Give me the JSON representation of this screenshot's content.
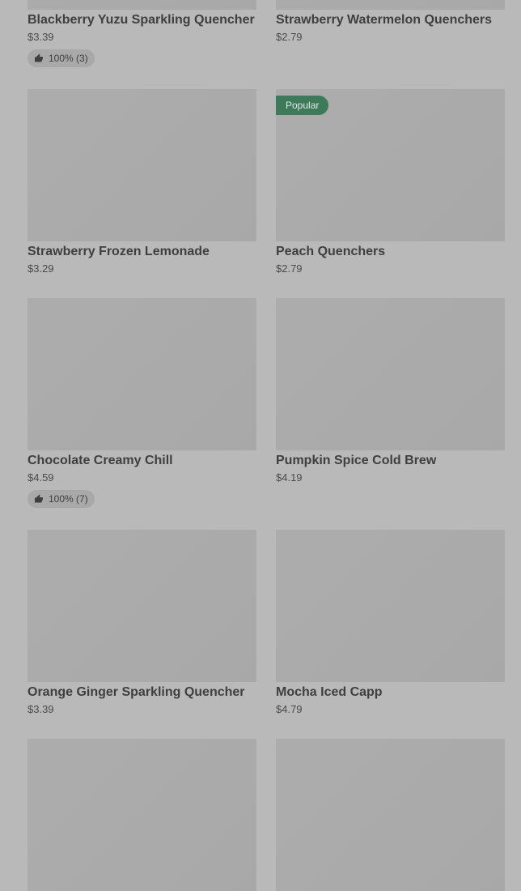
{
  "products": {
    "items": [
      {
        "name": "Blackberry Yuzu Sparkling Quencher",
        "price": "$3.39",
        "rating": "100% (3)"
      },
      {
        "name": "Strawberry Watermelon Quenchers",
        "price": "$2.79"
      },
      {
        "name": "Strawberry Frozen Lemonade",
        "price": "$3.29"
      },
      {
        "name": "Peach Quenchers",
        "price": "$2.79",
        "badge": "Popular"
      },
      {
        "name": "Chocolate Creamy Chill",
        "price": "$4.59",
        "rating": "100% (7)"
      },
      {
        "name": "Pumpkin Spice Cold Brew",
        "price": "$4.19"
      },
      {
        "name": "Orange Ginger Sparkling Quencher",
        "price": "$3.39"
      },
      {
        "name": "Mocha Iced Capp",
        "price": "$4.79"
      }
    ]
  },
  "icons": {
    "thumbs_up": "thumbs-up-icon"
  },
  "colors": {
    "background": "#b9b9b9",
    "image_placeholder": "#ababab",
    "badge": "#3d7a5a"
  }
}
